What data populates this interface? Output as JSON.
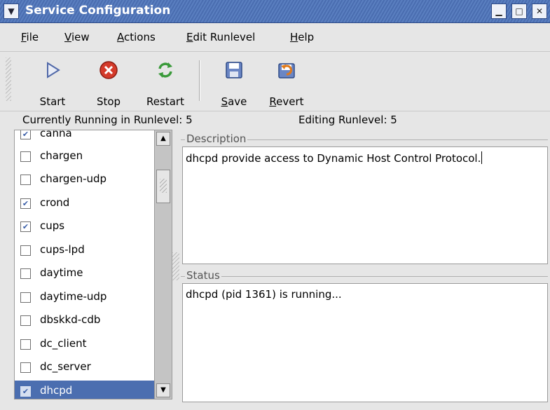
{
  "window": {
    "title": "Service Configuration",
    "controls": [
      "minimize",
      "maximize",
      "close"
    ]
  },
  "menu": [
    "File",
    "View",
    "Actions",
    "Edit Runlevel",
    "Help"
  ],
  "toolbar": {
    "start": "Start",
    "stop": "Stop",
    "restart": "Restart",
    "save": "Save",
    "revert": "Revert"
  },
  "status": {
    "running": "Currently Running in Runlevel: 5",
    "editing": "Editing Runlevel: 5"
  },
  "services": [
    {
      "name": "canna",
      "checked": true
    },
    {
      "name": "chargen",
      "checked": false
    },
    {
      "name": "chargen-udp",
      "checked": false
    },
    {
      "name": "crond",
      "checked": true
    },
    {
      "name": "cups",
      "checked": true
    },
    {
      "name": "cups-lpd",
      "checked": false
    },
    {
      "name": "daytime",
      "checked": false
    },
    {
      "name": "daytime-udp",
      "checked": false
    },
    {
      "name": "dbskkd-cdb",
      "checked": false
    },
    {
      "name": "dc_client",
      "checked": false
    },
    {
      "name": "dc_server",
      "checked": false
    },
    {
      "name": "dhcpd",
      "checked": true,
      "selected": true
    }
  ],
  "description": {
    "label": "Description",
    "text": "dhcpd provide access to Dynamic Host Control Protocol."
  },
  "statusPanel": {
    "label": "Status",
    "text": "dhcpd (pid 1361) is running..."
  },
  "colors": {
    "titlebar": "#4a6db0",
    "selection": "#4b6eb0"
  }
}
